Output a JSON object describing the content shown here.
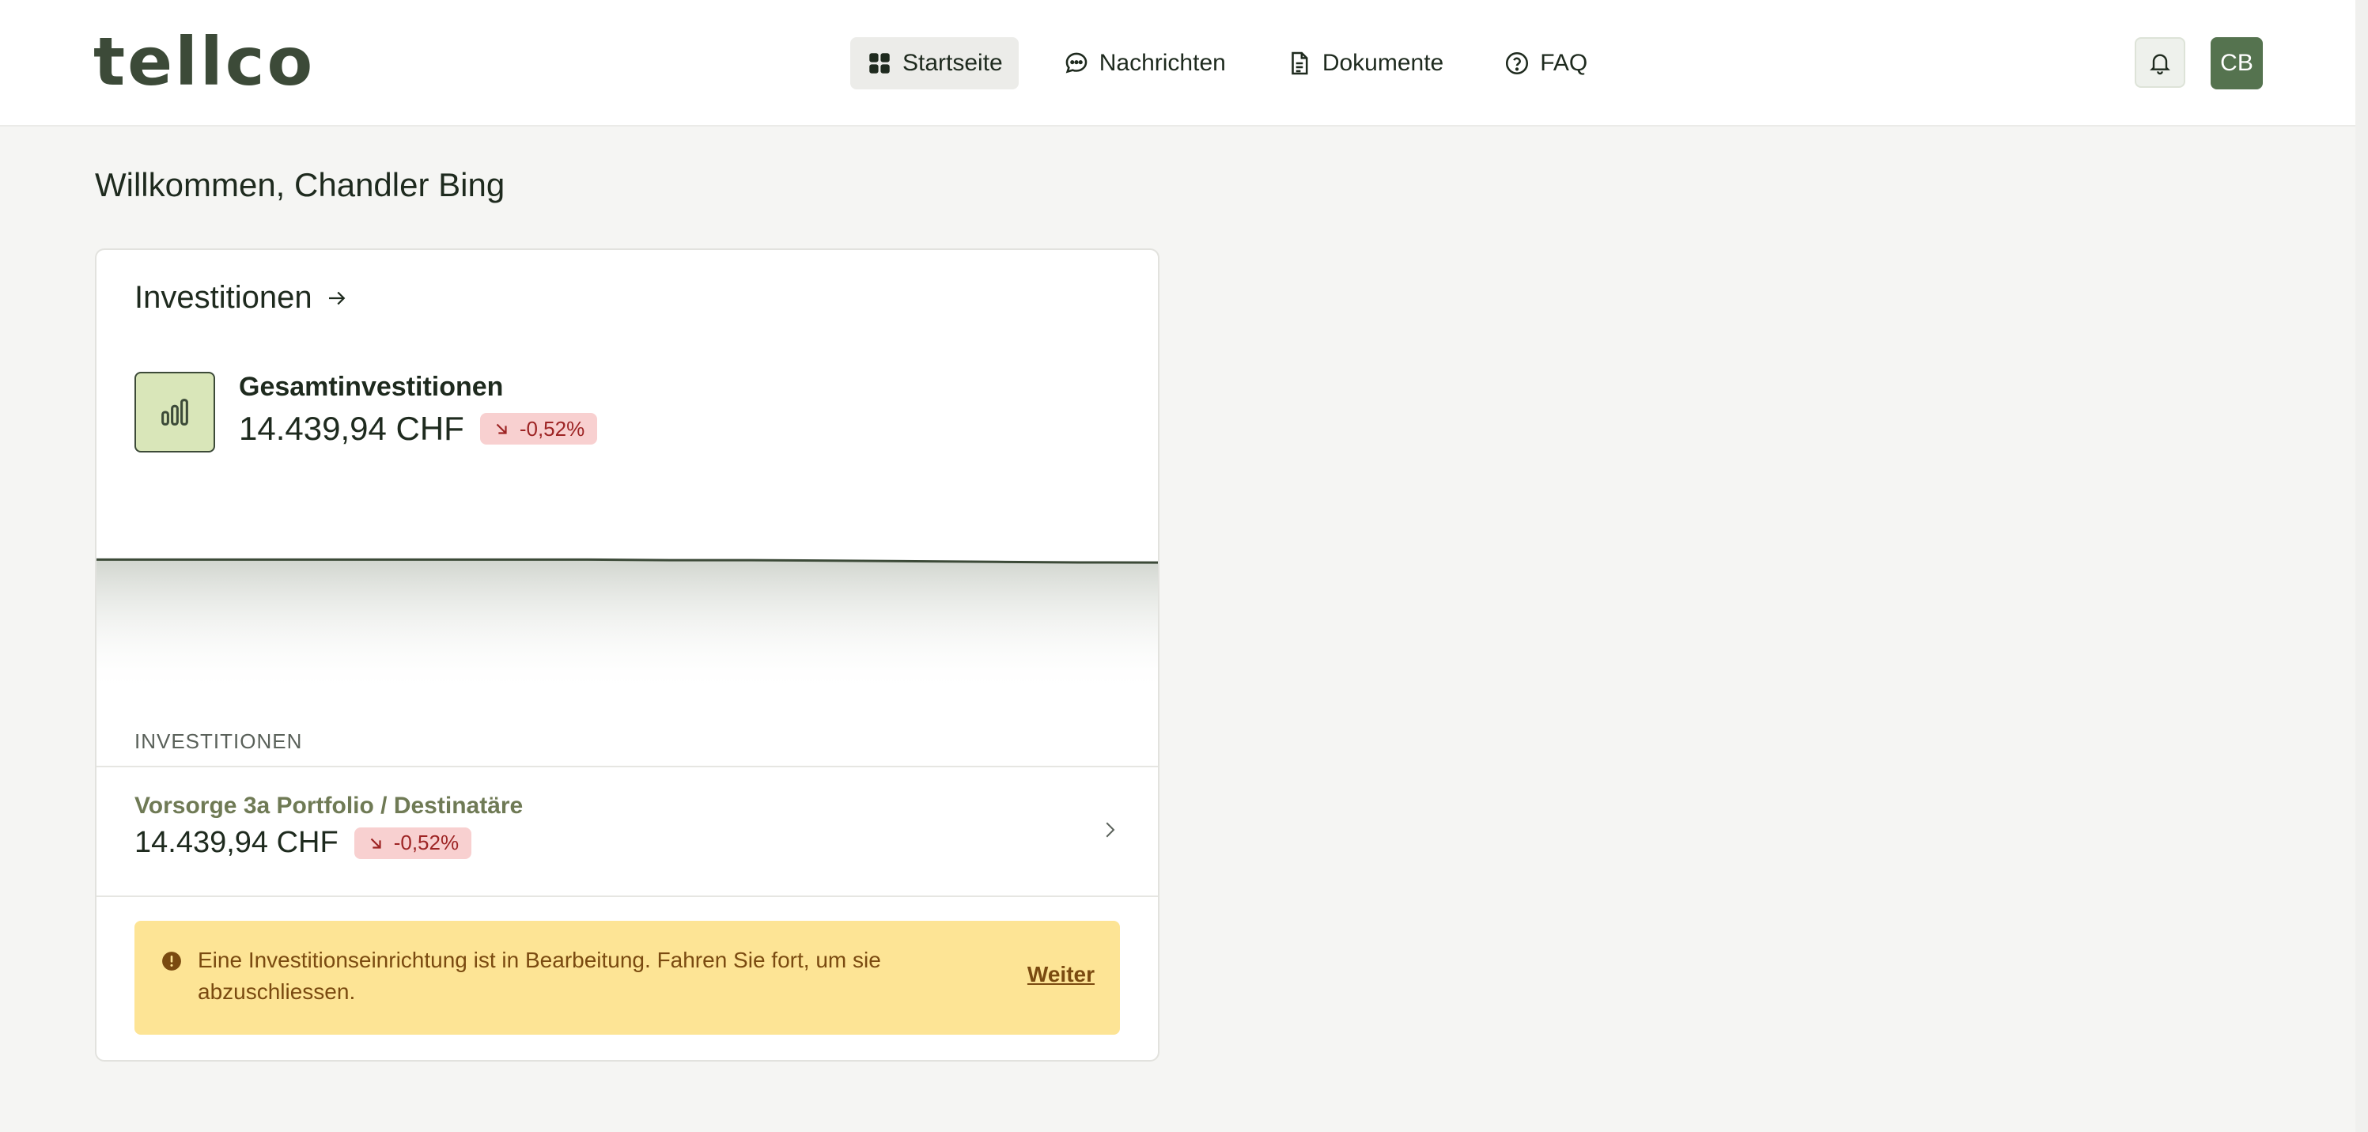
{
  "brand": {
    "logo_text": "tellco",
    "accent": "#55734f"
  },
  "nav": {
    "items": [
      {
        "label": "Startseite",
        "icon": "grid-icon",
        "active": true
      },
      {
        "label": "Nachrichten",
        "icon": "message-icon",
        "active": false
      },
      {
        "label": "Dokumente",
        "icon": "document-icon",
        "active": false
      },
      {
        "label": "FAQ",
        "icon": "help-circle-icon",
        "active": false
      }
    ]
  },
  "header": {
    "bell_icon": "bell-icon",
    "avatar_initials": "CB"
  },
  "welcome": "Willkommen, Chandler Bing",
  "investments": {
    "title": "Investitionen",
    "total_label": "Gesamtinvestitionen",
    "total_value": "14.439,94 CHF",
    "total_change": "-0,52%",
    "section_label": "INVESTITIONEN",
    "portfolios": [
      {
        "name": "Vorsorge 3a Portfolio / Destinatäre",
        "value": "14.439,94 CHF",
        "change": "-0,52%"
      }
    ]
  },
  "alert": {
    "text": "Eine Investitionseinrichtung ist in Bearbeitung. Fahren Sie fort, um sie abzuschliessen.",
    "link": "Weiter"
  },
  "chart_data": {
    "type": "area",
    "title": "",
    "xlabel": "",
    "ylabel": "",
    "values": [
      100,
      100,
      100,
      100,
      100,
      100,
      100,
      99.9,
      99.9,
      99.8,
      99.7,
      99.6,
      99.5,
      99.48
    ],
    "ylim": [
      95,
      101
    ],
    "grid": false,
    "color": "#3c4a38"
  }
}
